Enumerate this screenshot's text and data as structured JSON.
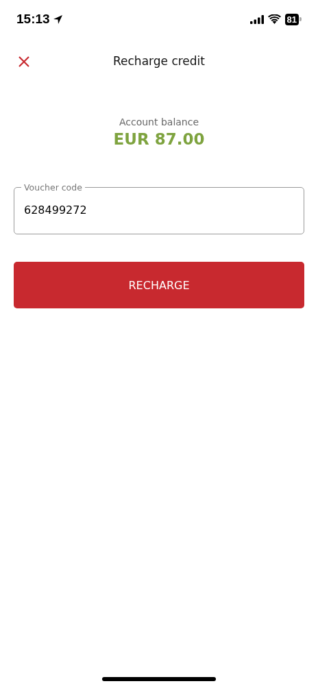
{
  "status_bar": {
    "time": "15:13",
    "battery": "81"
  },
  "header": {
    "title": "Recharge credit"
  },
  "balance": {
    "label": "Account balance",
    "amount": "EUR 87.00"
  },
  "voucher_field": {
    "label": "Voucher code",
    "value": "628499272"
  },
  "button": {
    "label": "RECHARGE"
  }
}
